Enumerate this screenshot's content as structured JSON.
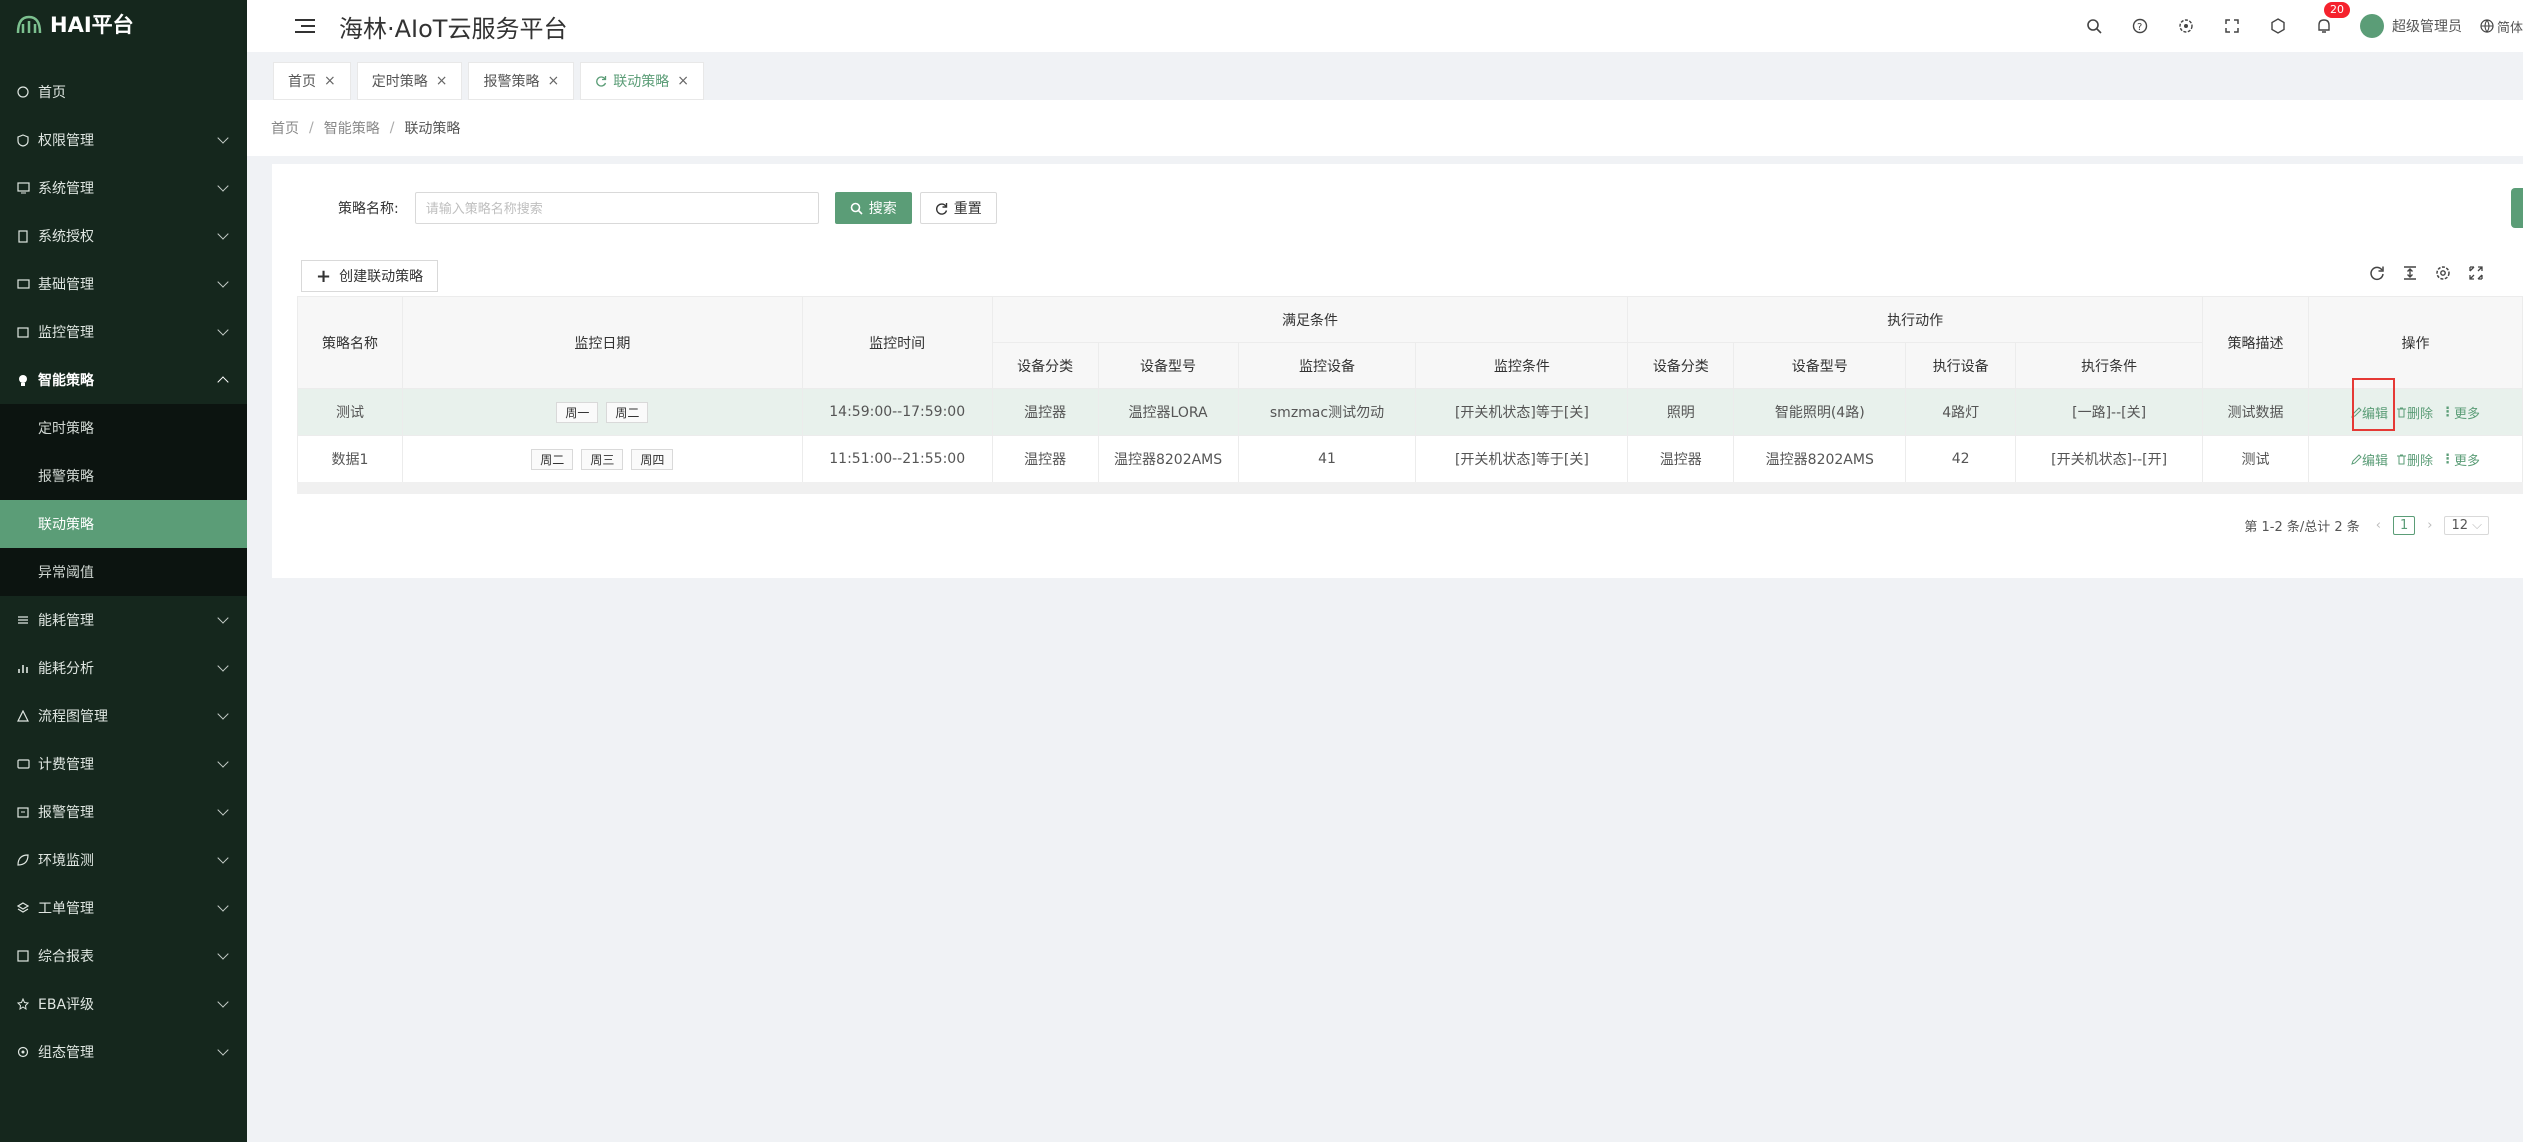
{
  "app": {
    "logo_text": "HAI平台",
    "title": "海林·AIoT云服务平台"
  },
  "header": {
    "notification_count": "20",
    "user_name": "超级管理员",
    "language": "简体"
  },
  "sidebar": {
    "items": [
      {
        "label": "首页"
      },
      {
        "label": "权限管理"
      },
      {
        "label": "系统管理"
      },
      {
        "label": "系统授权"
      },
      {
        "label": "基础管理"
      },
      {
        "label": "监控管理"
      },
      {
        "label": "智能策略"
      },
      {
        "label": "能耗管理"
      },
      {
        "label": "能耗分析"
      },
      {
        "label": "流程图管理"
      },
      {
        "label": "计费管理"
      },
      {
        "label": "报警管理"
      },
      {
        "label": "环境监测"
      },
      {
        "label": "工单管理"
      },
      {
        "label": "综合报表"
      },
      {
        "label": "EBA评级"
      },
      {
        "label": "组态管理"
      }
    ],
    "sub_items": [
      {
        "label": "定时策略"
      },
      {
        "label": "报警策略"
      },
      {
        "label": "联动策略"
      },
      {
        "label": "异常阈值"
      }
    ]
  },
  "tabs": [
    {
      "label": "首页"
    },
    {
      "label": "定时策略"
    },
    {
      "label": "报警策略"
    },
    {
      "label": "联动策略"
    }
  ],
  "breadcrumb": [
    "首页",
    "智能策略",
    "联动策略"
  ],
  "search": {
    "label": "策略名称:",
    "placeholder": "请输入策略名称搜索",
    "search_button": "搜索",
    "reset_button": "重置"
  },
  "create_button": "创建联动策略",
  "table": {
    "group_headers": {
      "condition": "满足条件",
      "action": "执行动作"
    },
    "headers": {
      "name": "策略名称",
      "date": "监控日期",
      "time": "监控时间",
      "c_category": "设备分类",
      "c_model": "设备型号",
      "c_device": "监控设备",
      "c_condition": "监控条件",
      "a_category": "设备分类",
      "a_model": "设备型号",
      "a_device": "执行设备",
      "a_condition": "执行条件",
      "desc": "策略描述",
      "ops": "操作"
    },
    "rows": [
      {
        "name": "测试",
        "days": [
          "周一",
          "周二"
        ],
        "time": "14:59:00--17:59:00",
        "c_category": "温控器",
        "c_model": "温控器LORA",
        "c_device": "smzmac测试勿动",
        "c_condition": "[开关机状态]等于[关]",
        "a_category": "照明",
        "a_model": "智能照明(4路)",
        "a_device": "4路灯",
        "a_condition": "[一路]--[关]",
        "desc": "测试数据"
      },
      {
        "name": "数据1",
        "days": [
          "周二",
          "周三",
          "周四"
        ],
        "time": "11:51:00--21:55:00",
        "c_category": "温控器",
        "c_model": "温控器8202AMS",
        "c_device": "41",
        "c_condition": "[开关机状态]等于[关]",
        "a_category": "温控器",
        "a_model": "温控器8202AMS",
        "a_device": "42",
        "a_condition": "[开关机状态]--[开]",
        "desc": "测试"
      }
    ],
    "ops": {
      "edit": "编辑",
      "delete": "删除",
      "more": "更多"
    }
  },
  "pagination": {
    "summary": "第 1-2 条/总计 2 条",
    "current": "1",
    "page_size": "12"
  },
  "colors": {
    "primary": "#5b9d77",
    "sidebar_bg": "#15271d",
    "badge": "#f5222d"
  }
}
